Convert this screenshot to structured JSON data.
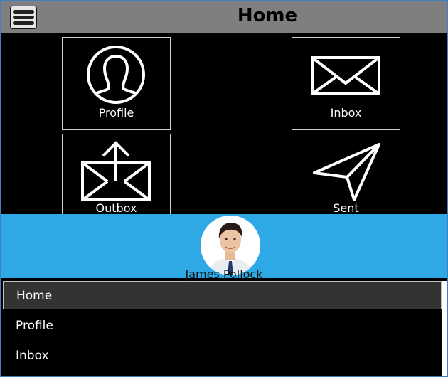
{
  "header": {
    "title": "Home",
    "menu_icon": "hamburger-icon"
  },
  "tiles": [
    {
      "label": "Profile",
      "icon": "person-icon"
    },
    {
      "label": "Inbox",
      "icon": "envelope-icon"
    },
    {
      "label": "Outbox",
      "icon": "envelope-upload-icon"
    },
    {
      "label": "Sent",
      "icon": "paper-plane-icon"
    }
  ],
  "user": {
    "name": "James Pollock"
  },
  "colors": {
    "header_bg": "#7f7f7f",
    "accent": "#2fa9e6",
    "background": "#000000",
    "selected_item_bg": "#333333"
  },
  "menu": {
    "items": [
      "Home",
      "Profile",
      "Inbox"
    ],
    "selected": "Home"
  }
}
